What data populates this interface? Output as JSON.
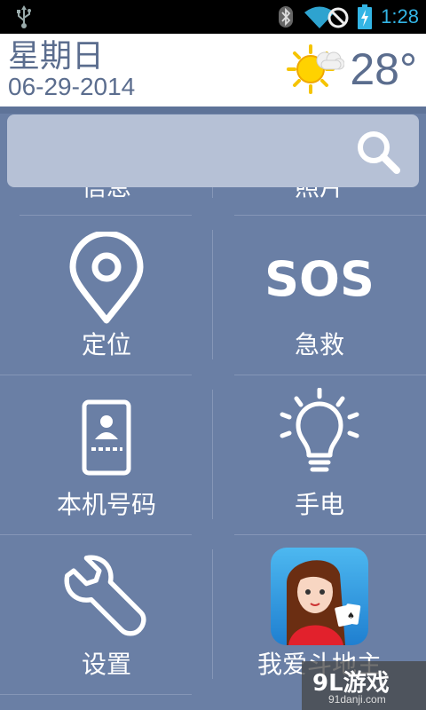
{
  "status_bar": {
    "time": "1:28"
  },
  "header": {
    "weekday": "星期日",
    "date": "06-29-2014",
    "temperature": "28°",
    "weather_icon": "sun-cloud-icon"
  },
  "search": {
    "placeholder": "",
    "icon": "search-icon"
  },
  "grid": {
    "row0": {
      "left_label": "信息",
      "right_label": "照片"
    },
    "items": [
      {
        "label": "定位",
        "icon": "location-pin-icon"
      },
      {
        "label": "急救",
        "icon": "sos-icon"
      },
      {
        "label": "本机号码",
        "icon": "phone-contact-icon"
      },
      {
        "label": "手电",
        "icon": "lightbulb-icon"
      },
      {
        "label": "设置",
        "icon": "wrench-icon"
      },
      {
        "label": "我爱斗地主",
        "icon": "card-game-app-icon"
      }
    ]
  },
  "watermark": {
    "brand": "9L游戏",
    "url": "91danji.com"
  },
  "colors": {
    "background": "#6a7fa5",
    "accent": "#33b5e5",
    "text_dark": "#5b6d8e"
  }
}
